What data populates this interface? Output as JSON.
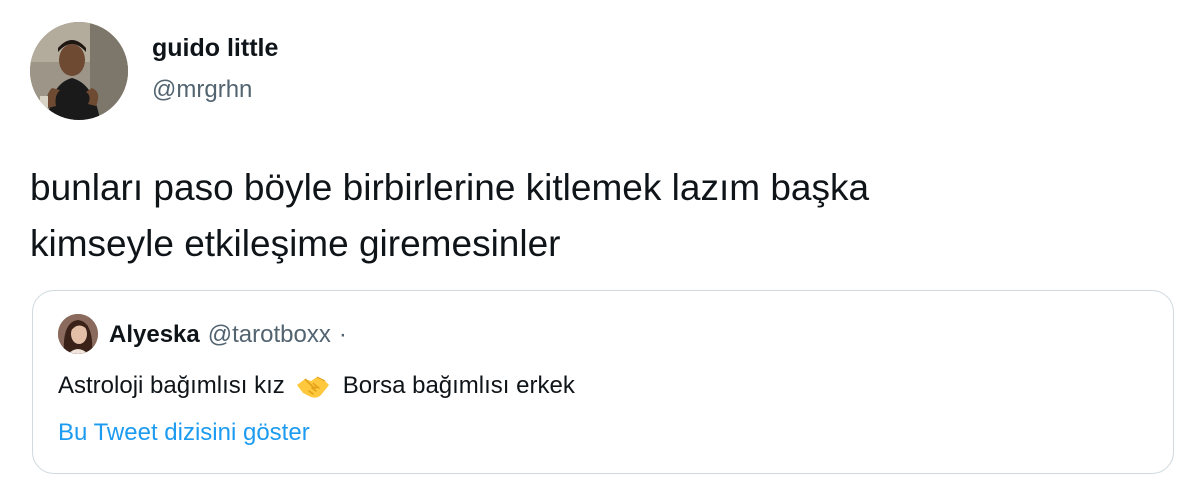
{
  "tweet": {
    "display_name": "guido little",
    "handle": "@mrgrhn",
    "text_lines": [
      "bunları paso böyle birbirlerine kitlemek lazım başka",
      "kimseyle etkileşime giremesinler"
    ]
  },
  "quoted_tweet": {
    "display_name": "Alyeska",
    "handle": "@tarotboxx",
    "separator": "·",
    "text_before_emoji": "Astroloji bağımlısı kız",
    "emoji": "handshake-emoji",
    "text_after_emoji": "Borsa bağımlısı erkek",
    "thread_link": "Bu Tweet dizisini göster"
  },
  "colors": {
    "text_primary": "#0f1419",
    "text_secondary": "#536471",
    "link": "#1d9bf0",
    "border": "#cfd9de"
  }
}
